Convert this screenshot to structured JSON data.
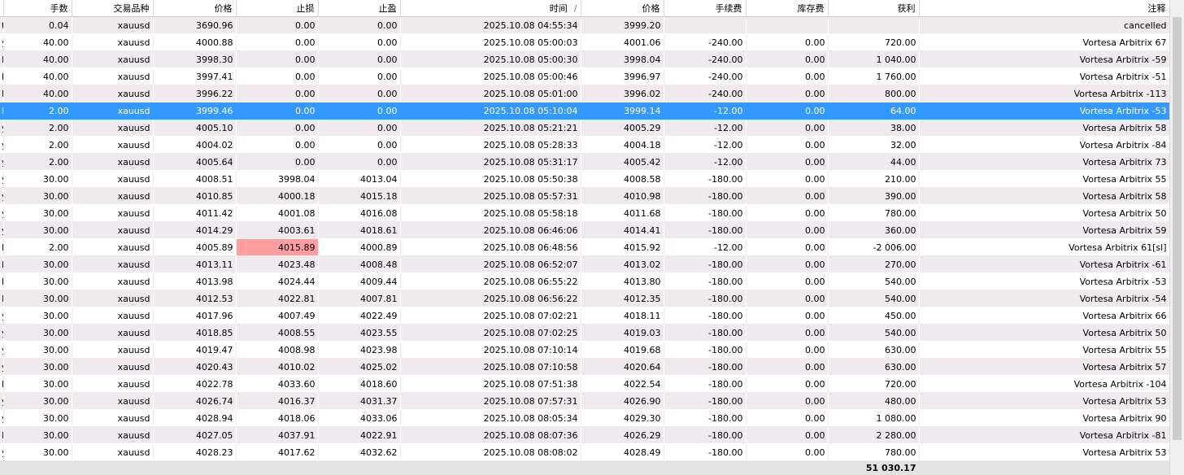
{
  "columns": [
    "",
    "手数",
    "交易品种",
    "价格",
    "止损",
    "止盈",
    "时间",
    "价格",
    "手续费",
    "库存费",
    "获利",
    "注释"
  ],
  "sort_indicator": "/",
  "rows": [
    [
      "t",
      "0.04",
      "xauusd",
      "3690.96",
      "0.00",
      "0.00",
      "2025.10.08 04:55:34",
      "3999.20",
      "",
      "",
      "",
      "cancelled"
    ],
    [
      "y",
      "40.00",
      "xauusd",
      "4000.88",
      "0.00",
      "0.00",
      "2025.10.08 05:00:03",
      "4001.06",
      "-240.00",
      "0.00",
      "720.00",
      "Vortesa Arbitrix 67"
    ],
    [
      "l",
      "40.00",
      "xauusd",
      "3998.30",
      "0.00",
      "0.00",
      "2025.10.08 05:00:30",
      "3998.04",
      "-240.00",
      "0.00",
      "1 040.00",
      "Vortesa Arbitrix -59"
    ],
    [
      "l",
      "40.00",
      "xauusd",
      "3997.41",
      "0.00",
      "0.00",
      "2025.10.08 05:00:46",
      "3996.97",
      "-240.00",
      "0.00",
      "1 760.00",
      "Vortesa Arbitrix -51"
    ],
    [
      "l",
      "40.00",
      "xauusd",
      "3996.22",
      "0.00",
      "0.00",
      "2025.10.08 05:01:00",
      "3996.02",
      "-240.00",
      "0.00",
      "800.00",
      "Vortesa Arbitrix -113"
    ],
    [
      "l",
      "2.00",
      "xauusd",
      "3999.46",
      "0.00",
      "0.00",
      "2025.10.08 05:10:04",
      "3999.14",
      "-12.00",
      "0.00",
      "64.00",
      "Vortesa Arbitrix -53"
    ],
    [
      "y",
      "2.00",
      "xauusd",
      "4005.10",
      "0.00",
      "0.00",
      "2025.10.08 05:21:21",
      "4005.29",
      "-12.00",
      "0.00",
      "38.00",
      "Vortesa Arbitrix 58"
    ],
    [
      "y",
      "2.00",
      "xauusd",
      "4004.02",
      "0.00",
      "0.00",
      "2025.10.08 05:28:33",
      "4004.18",
      "-12.00",
      "0.00",
      "32.00",
      "Vortesa Arbitrix -84"
    ],
    [
      "y",
      "2.00",
      "xauusd",
      "4005.64",
      "0.00",
      "0.00",
      "2025.10.08 05:31:17",
      "4005.42",
      "-12.00",
      "0.00",
      "44.00",
      "Vortesa Arbitrix 73"
    ],
    [
      "y",
      "30.00",
      "xauusd",
      "4008.51",
      "3998.04",
      "4013.04",
      "2025.10.08 05:50:38",
      "4008.58",
      "-180.00",
      "0.00",
      "210.00",
      "Vortesa Arbitrix 55"
    ],
    [
      "y",
      "30.00",
      "xauusd",
      "4010.85",
      "4000.18",
      "4015.18",
      "2025.10.08 05:57:31",
      "4010.98",
      "-180.00",
      "0.00",
      "390.00",
      "Vortesa Arbitrix 58"
    ],
    [
      "y",
      "30.00",
      "xauusd",
      "4011.42",
      "4001.08",
      "4016.08",
      "2025.10.08 05:58:18",
      "4011.68",
      "-180.00",
      "0.00",
      "780.00",
      "Vortesa Arbitrix 50"
    ],
    [
      "y",
      "30.00",
      "xauusd",
      "4014.29",
      "4003.61",
      "4018.61",
      "2025.10.08 06:46:06",
      "4014.41",
      "-180.00",
      "0.00",
      "360.00",
      "Vortesa Arbitrix 59"
    ],
    [
      "l",
      "2.00",
      "xauusd",
      "4005.89",
      "4015.89",
      "4000.89",
      "2025.10.08 06:48:56",
      "4015.92",
      "-12.00",
      "0.00",
      "-2 006.00",
      "Vortesa Arbitrix 61[sl]"
    ],
    [
      "l",
      "30.00",
      "xauusd",
      "4013.11",
      "4023.48",
      "4008.48",
      "2025.10.08 06:52:07",
      "4013.02",
      "-180.00",
      "0.00",
      "270.00",
      "Vortesa Arbitrix -61"
    ],
    [
      "l",
      "30.00",
      "xauusd",
      "4013.98",
      "4024.44",
      "4009.44",
      "2025.10.08 06:55:22",
      "4013.80",
      "-180.00",
      "0.00",
      "540.00",
      "Vortesa Arbitrix -53"
    ],
    [
      "l",
      "30.00",
      "xauusd",
      "4012.53",
      "4022.81",
      "4007.81",
      "2025.10.08 06:56:22",
      "4012.35",
      "-180.00",
      "0.00",
      "540.00",
      "Vortesa Arbitrix -54"
    ],
    [
      "y",
      "30.00",
      "xauusd",
      "4017.96",
      "4007.49",
      "4022.49",
      "2025.10.08 07:02:21",
      "4018.11",
      "-180.00",
      "0.00",
      "450.00",
      "Vortesa Arbitrix 66"
    ],
    [
      "y",
      "30.00",
      "xauusd",
      "4018.85",
      "4008.55",
      "4023.55",
      "2025.10.08 07:02:25",
      "4019.03",
      "-180.00",
      "0.00",
      "540.00",
      "Vortesa Arbitrix 50"
    ],
    [
      "y",
      "30.00",
      "xauusd",
      "4019.47",
      "4008.98",
      "4023.98",
      "2025.10.08 07:10:14",
      "4019.68",
      "-180.00",
      "0.00",
      "630.00",
      "Vortesa Arbitrix 55"
    ],
    [
      "y",
      "30.00",
      "xauusd",
      "4020.43",
      "4010.02",
      "4025.02",
      "2025.10.08 07:10:58",
      "4020.64",
      "-180.00",
      "0.00",
      "630.00",
      "Vortesa Arbitrix 57"
    ],
    [
      "l",
      "30.00",
      "xauusd",
      "4022.78",
      "4033.60",
      "4018.60",
      "2025.10.08 07:51:38",
      "4022.54",
      "-180.00",
      "0.00",
      "720.00",
      "Vortesa Arbitrix -104"
    ],
    [
      "y",
      "30.00",
      "xauusd",
      "4026.74",
      "4016.37",
      "4031.37",
      "2025.10.08 07:57:31",
      "4026.90",
      "-180.00",
      "0.00",
      "480.00",
      "Vortesa Arbitrix 53"
    ],
    [
      "y",
      "30.00",
      "xauusd",
      "4028.94",
      "4018.06",
      "4033.06",
      "2025.10.08 08:05:34",
      "4029.30",
      "-180.00",
      "0.00",
      "1 080.00",
      "Vortesa Arbitrix 90"
    ],
    [
      "l",
      "30.00",
      "xauusd",
      "4027.05",
      "4037.91",
      "4022.91",
      "2025.10.08 08:07:36",
      "4026.29",
      "-180.00",
      "0.00",
      "2 280.00",
      "Vortesa Arbitrix -81"
    ],
    [
      "y",
      "30.00",
      "xauusd",
      "4028.23",
      "4017.62",
      "4032.62",
      "2025.10.08 08:08:02",
      "4028.49",
      "-180.00",
      "0.00",
      "780.00",
      "Vortesa Arbitrix 53"
    ]
  ],
  "selected_row_index": 5,
  "highlight_cell": {
    "row": 13,
    "col": 4,
    "color": "#ff9ea0"
  },
  "colors": {
    "selection": "#3399ff",
    "stripe": "#eeeaee",
    "total_bar": "#e3e3e3",
    "stop_loss_hit": "#ff9ea0"
  },
  "total_profit": "51 030.17"
}
